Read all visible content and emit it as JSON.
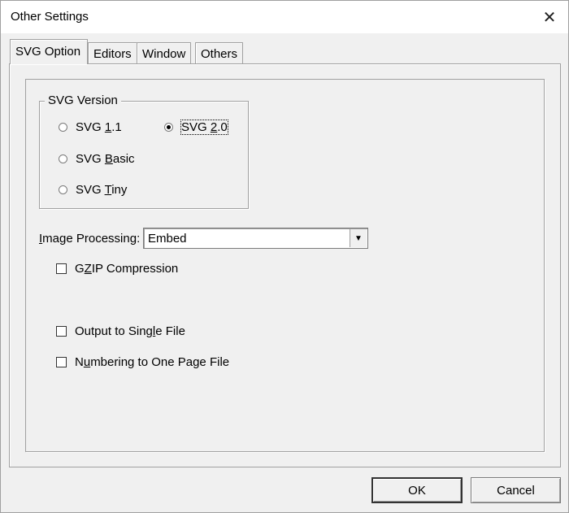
{
  "window": {
    "title": "Other Settings",
    "close_icon": "close-icon",
    "close_glyph": "✕"
  },
  "tabs": [
    {
      "label": "SVG Option",
      "active": true
    },
    {
      "label": "Editors",
      "active": false
    },
    {
      "label": "Window",
      "active": false
    },
    {
      "label": "Others",
      "active": false
    }
  ],
  "svg_version": {
    "title": "SVG Version",
    "options": [
      {
        "pre": "SVG ",
        "mn": "1",
        "post": ".1",
        "selected": false
      },
      {
        "pre": "SVG ",
        "mn": "2",
        "post": ".0",
        "selected": true
      },
      {
        "pre": "SVG ",
        "mn": "B",
        "post": "asic",
        "selected": false
      },
      {
        "pre": "SVG ",
        "mn": "T",
        "post": "iny",
        "selected": false
      }
    ]
  },
  "image_processing": {
    "label_mn": "I",
    "label_rest": "mage Processing:",
    "value": "Embed",
    "arrow_glyph": "▼"
  },
  "checkboxes": [
    {
      "pre": "G",
      "mn": "Z",
      "post": "IP Compression",
      "checked": false
    },
    {
      "pre": "Output to Sing",
      "mn": "l",
      "post": "e File",
      "checked": false
    },
    {
      "pre": "N",
      "mn": "u",
      "post": "mbering to One Page File",
      "checked": false
    }
  ],
  "buttons": {
    "ok": "OK",
    "cancel": "Cancel"
  }
}
